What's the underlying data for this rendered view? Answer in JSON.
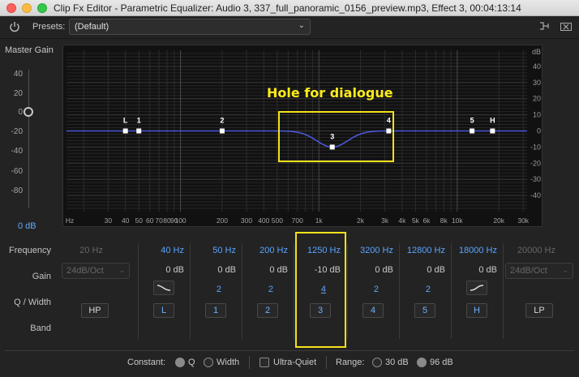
{
  "window": {
    "title": "Clip Fx Editor - Parametric Equalizer: Audio 3, 337_full_panoramic_0156_preview.mp3, Effect 3, 00:04:13:14"
  },
  "toolbar": {
    "presets_label": "Presets:",
    "preset_value": "(Default)"
  },
  "master_gain": {
    "label": "Master Gain",
    "ticks": [
      "40",
      "20",
      "0",
      "-20",
      "-40",
      "-60",
      "-80"
    ],
    "value": "0 dB"
  },
  "graph": {
    "db_unit": "dB",
    "db_ticks": [
      "40",
      "30",
      "20",
      "10",
      "0",
      "-10",
      "-20",
      "-30",
      "-40"
    ],
    "freq_ticks": [
      "Hz",
      "30",
      "40",
      "50",
      "60",
      "70",
      "80",
      "90",
      "100",
      "200",
      "300",
      "400",
      "500",
      "700",
      "1k",
      "2k",
      "3k",
      "4k",
      "5k",
      "6k",
      "8k",
      "10k",
      "20k",
      "30k"
    ],
    "nodes": [
      {
        "label": "L",
        "freq": 40,
        "gain": 0
      },
      {
        "label": "1",
        "freq": 50,
        "gain": 0
      },
      {
        "label": "2",
        "freq": 200,
        "gain": 0
      },
      {
        "label": "3",
        "freq": 1250,
        "gain": -10
      },
      {
        "label": "4",
        "freq": 3200,
        "gain": 0
      },
      {
        "label": "5",
        "freq": 12800,
        "gain": 0
      },
      {
        "label": "H",
        "freq": 18000,
        "gain": 0
      }
    ],
    "curve_color": "#4b57d6",
    "annotation": "Hole for dialogue",
    "annotation_color": "#f4e21b"
  },
  "rows": {
    "frequency": "Frequency",
    "gain": "Gain",
    "q": "Q / Width",
    "band": "Band"
  },
  "bands": {
    "hp_freq": "20 Hz",
    "hp_slope": "24dB/Oct",
    "hp_button": "HP",
    "low_shelf": {
      "freq": "40 Hz",
      "gain": "0 dB",
      "button": "L"
    },
    "b1": {
      "freq": "50 Hz",
      "gain": "0 dB",
      "q": "2",
      "button": "1"
    },
    "b2": {
      "freq": "200 Hz",
      "gain": "0 dB",
      "q": "2",
      "button": "2"
    },
    "b3": {
      "freq": "1250 Hz",
      "gain": "-10 dB",
      "q": "4",
      "button": "3"
    },
    "b4": {
      "freq": "3200 Hz",
      "gain": "0 dB",
      "q": "2",
      "button": "4"
    },
    "b5": {
      "freq": "12800 Hz",
      "gain": "0 dB",
      "q": "2",
      "button": "5"
    },
    "high_shelf": {
      "freq": "18000 Hz",
      "gain": "0 dB",
      "button": "H"
    },
    "lp_freq": "20000 Hz",
    "lp_slope": "24dB/Oct",
    "lp_button": "LP"
  },
  "footer": {
    "constant_label": "Constant:",
    "q_label": "Q",
    "width_label": "Width",
    "ultra_quiet_label": "Ultra-Quiet",
    "range_label": "Range:",
    "range_30": "30 dB",
    "range_96": "96 dB",
    "constant_selected": "Q",
    "range_selected": "96 dB",
    "ultra_quiet_checked": false
  }
}
